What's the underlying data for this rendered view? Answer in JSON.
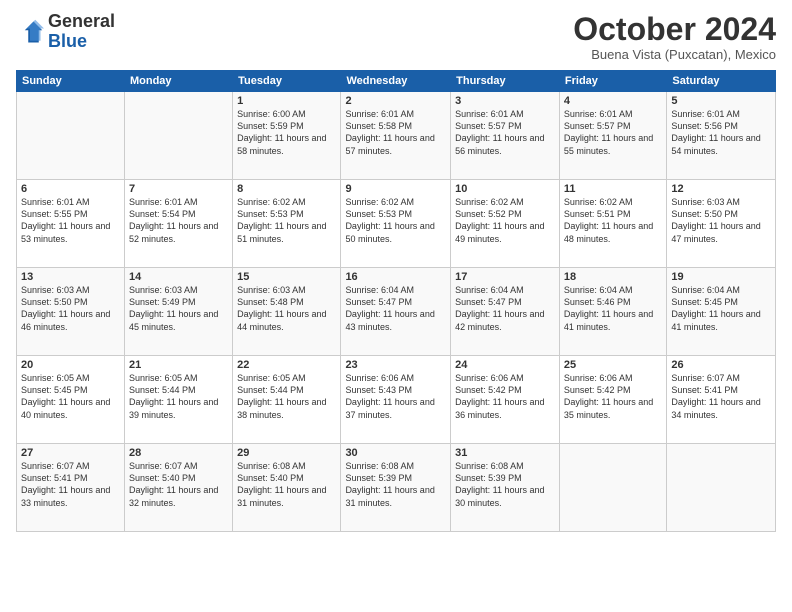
{
  "header": {
    "logo_line1": "General",
    "logo_line2": "Blue",
    "month": "October 2024",
    "location": "Buena Vista (Puxcatan), Mexico"
  },
  "days_of_week": [
    "Sunday",
    "Monday",
    "Tuesday",
    "Wednesday",
    "Thursday",
    "Friday",
    "Saturday"
  ],
  "weeks": [
    [
      {
        "day": "",
        "info": ""
      },
      {
        "day": "",
        "info": ""
      },
      {
        "day": "1",
        "info": "Sunrise: 6:00 AM\nSunset: 5:59 PM\nDaylight: 11 hours and 58 minutes."
      },
      {
        "day": "2",
        "info": "Sunrise: 6:01 AM\nSunset: 5:58 PM\nDaylight: 11 hours and 57 minutes."
      },
      {
        "day": "3",
        "info": "Sunrise: 6:01 AM\nSunset: 5:57 PM\nDaylight: 11 hours and 56 minutes."
      },
      {
        "day": "4",
        "info": "Sunrise: 6:01 AM\nSunset: 5:57 PM\nDaylight: 11 hours and 55 minutes."
      },
      {
        "day": "5",
        "info": "Sunrise: 6:01 AM\nSunset: 5:56 PM\nDaylight: 11 hours and 54 minutes."
      }
    ],
    [
      {
        "day": "6",
        "info": "Sunrise: 6:01 AM\nSunset: 5:55 PM\nDaylight: 11 hours and 53 minutes."
      },
      {
        "day": "7",
        "info": "Sunrise: 6:01 AM\nSunset: 5:54 PM\nDaylight: 11 hours and 52 minutes."
      },
      {
        "day": "8",
        "info": "Sunrise: 6:02 AM\nSunset: 5:53 PM\nDaylight: 11 hours and 51 minutes."
      },
      {
        "day": "9",
        "info": "Sunrise: 6:02 AM\nSunset: 5:53 PM\nDaylight: 11 hours and 50 minutes."
      },
      {
        "day": "10",
        "info": "Sunrise: 6:02 AM\nSunset: 5:52 PM\nDaylight: 11 hours and 49 minutes."
      },
      {
        "day": "11",
        "info": "Sunrise: 6:02 AM\nSunset: 5:51 PM\nDaylight: 11 hours and 48 minutes."
      },
      {
        "day": "12",
        "info": "Sunrise: 6:03 AM\nSunset: 5:50 PM\nDaylight: 11 hours and 47 minutes."
      }
    ],
    [
      {
        "day": "13",
        "info": "Sunrise: 6:03 AM\nSunset: 5:50 PM\nDaylight: 11 hours and 46 minutes."
      },
      {
        "day": "14",
        "info": "Sunrise: 6:03 AM\nSunset: 5:49 PM\nDaylight: 11 hours and 45 minutes."
      },
      {
        "day": "15",
        "info": "Sunrise: 6:03 AM\nSunset: 5:48 PM\nDaylight: 11 hours and 44 minutes."
      },
      {
        "day": "16",
        "info": "Sunrise: 6:04 AM\nSunset: 5:47 PM\nDaylight: 11 hours and 43 minutes."
      },
      {
        "day": "17",
        "info": "Sunrise: 6:04 AM\nSunset: 5:47 PM\nDaylight: 11 hours and 42 minutes."
      },
      {
        "day": "18",
        "info": "Sunrise: 6:04 AM\nSunset: 5:46 PM\nDaylight: 11 hours and 41 minutes."
      },
      {
        "day": "19",
        "info": "Sunrise: 6:04 AM\nSunset: 5:45 PM\nDaylight: 11 hours and 41 minutes."
      }
    ],
    [
      {
        "day": "20",
        "info": "Sunrise: 6:05 AM\nSunset: 5:45 PM\nDaylight: 11 hours and 40 minutes."
      },
      {
        "day": "21",
        "info": "Sunrise: 6:05 AM\nSunset: 5:44 PM\nDaylight: 11 hours and 39 minutes."
      },
      {
        "day": "22",
        "info": "Sunrise: 6:05 AM\nSunset: 5:44 PM\nDaylight: 11 hours and 38 minutes."
      },
      {
        "day": "23",
        "info": "Sunrise: 6:06 AM\nSunset: 5:43 PM\nDaylight: 11 hours and 37 minutes."
      },
      {
        "day": "24",
        "info": "Sunrise: 6:06 AM\nSunset: 5:42 PM\nDaylight: 11 hours and 36 minutes."
      },
      {
        "day": "25",
        "info": "Sunrise: 6:06 AM\nSunset: 5:42 PM\nDaylight: 11 hours and 35 minutes."
      },
      {
        "day": "26",
        "info": "Sunrise: 6:07 AM\nSunset: 5:41 PM\nDaylight: 11 hours and 34 minutes."
      }
    ],
    [
      {
        "day": "27",
        "info": "Sunrise: 6:07 AM\nSunset: 5:41 PM\nDaylight: 11 hours and 33 minutes."
      },
      {
        "day": "28",
        "info": "Sunrise: 6:07 AM\nSunset: 5:40 PM\nDaylight: 11 hours and 32 minutes."
      },
      {
        "day": "29",
        "info": "Sunrise: 6:08 AM\nSunset: 5:40 PM\nDaylight: 11 hours and 31 minutes."
      },
      {
        "day": "30",
        "info": "Sunrise: 6:08 AM\nSunset: 5:39 PM\nDaylight: 11 hours and 31 minutes."
      },
      {
        "day": "31",
        "info": "Sunrise: 6:08 AM\nSunset: 5:39 PM\nDaylight: 11 hours and 30 minutes."
      },
      {
        "day": "",
        "info": ""
      },
      {
        "day": "",
        "info": ""
      }
    ]
  ]
}
